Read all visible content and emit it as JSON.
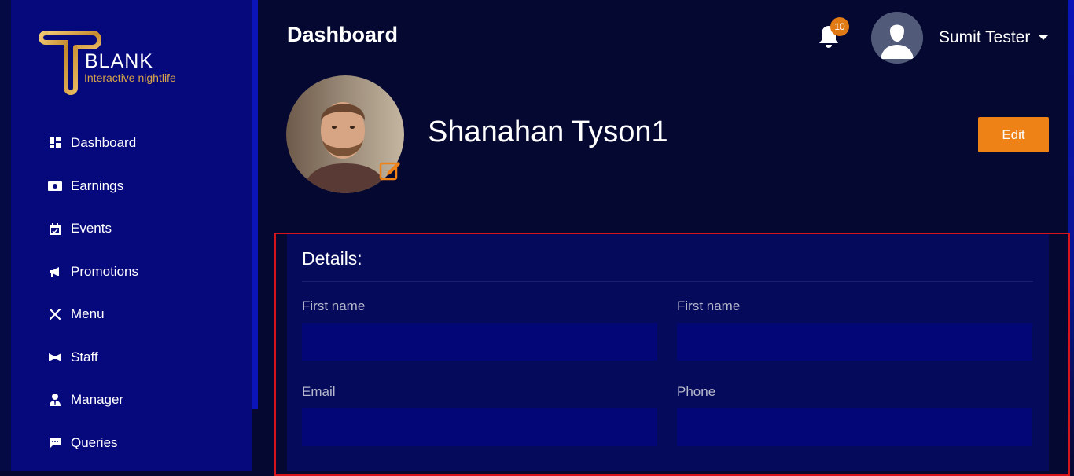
{
  "brand": {
    "name": "BLANK",
    "tagline": "Interactive nightlife",
    "gold": "#d7a44a"
  },
  "sidebar": {
    "items": [
      {
        "label": "Dashboard",
        "icon": "dashboard-icon"
      },
      {
        "label": "Earnings",
        "icon": "money-icon"
      },
      {
        "label": "Events",
        "icon": "calendar-icon"
      },
      {
        "label": "Promotions",
        "icon": "megaphone-icon"
      },
      {
        "label": "Menu",
        "icon": "utensils-icon"
      },
      {
        "label": "Staff",
        "icon": "bowtie-icon"
      },
      {
        "label": "Manager",
        "icon": "user-tie-icon"
      },
      {
        "label": "Queries",
        "icon": "chat-icon"
      }
    ]
  },
  "header": {
    "title": "Dashboard",
    "notification_count": "10",
    "user_name": "Sumit Tester"
  },
  "profile": {
    "name": "Shanahan Tyson1",
    "edit_label": "Edit"
  },
  "details": {
    "title": "Details:",
    "fields": {
      "first_name": {
        "label": "First name",
        "value": ""
      },
      "last_name": {
        "label": "First name",
        "value": ""
      },
      "email": {
        "label": "Email",
        "value": ""
      },
      "phone": {
        "label": "Phone",
        "value": ""
      }
    }
  },
  "colors": {
    "accent": "#ee8216",
    "sidebar": "#06097c",
    "background": "#050830",
    "highlight_border": "#d6141c"
  }
}
